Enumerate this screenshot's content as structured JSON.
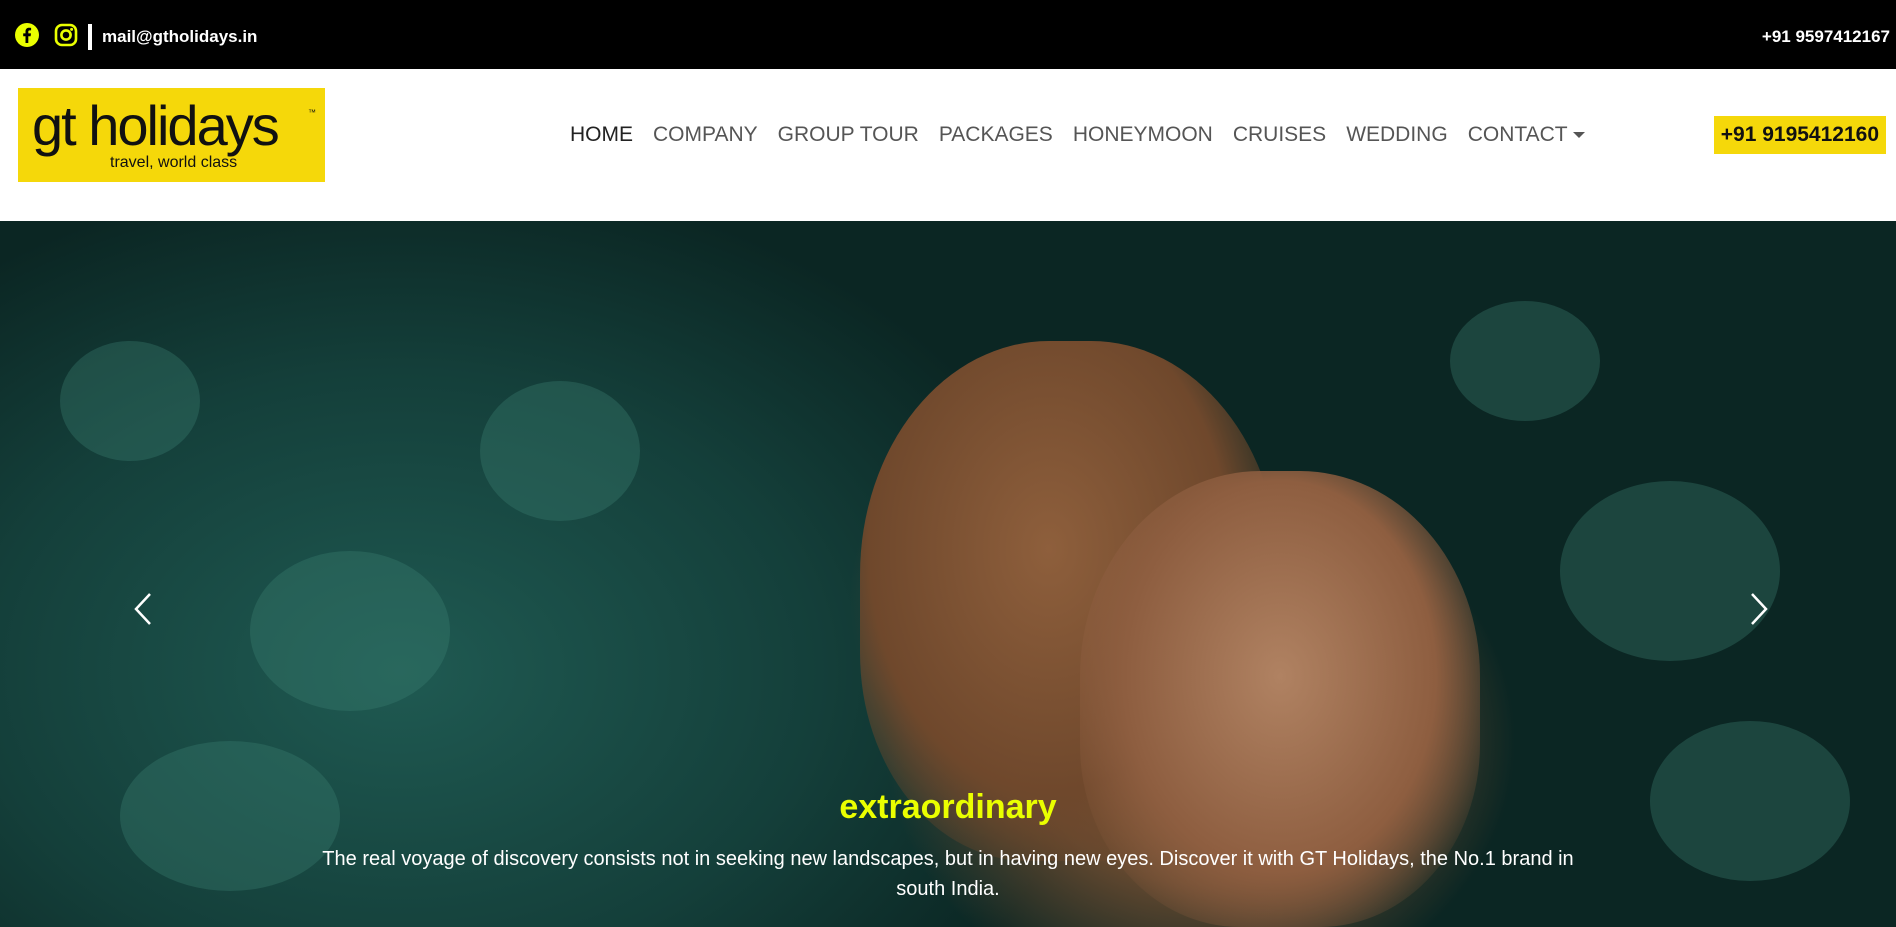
{
  "topbar": {
    "email": "mail@gtholidays.in",
    "phone": "+91 9597412167",
    "icons": [
      "facebook-icon",
      "instagram-icon"
    ],
    "icon_color": "#eaff00"
  },
  "logo": {
    "brand": "gt holidays",
    "tm": "™",
    "tagline": "travel, world class",
    "bg_color": "#f5d80a"
  },
  "nav": {
    "items": [
      {
        "label": "HOME"
      },
      {
        "label": "COMPANY"
      },
      {
        "label": "GROUP TOUR"
      },
      {
        "label": "PACKAGES"
      },
      {
        "label": "HONEYMOON"
      },
      {
        "label": "CRUISES"
      },
      {
        "label": "WEDDING"
      },
      {
        "label": "CONTACT"
      }
    ],
    "active": "HOME",
    "call_button": "+91 9195412160"
  },
  "hero": {
    "title": "extraordinary",
    "text": "The real voyage of discovery consists not in seeking new landscapes, but in having new eyes. Discover it with GT Holidays, the No.1 brand in south India.",
    "title_color": "#eaff00"
  }
}
